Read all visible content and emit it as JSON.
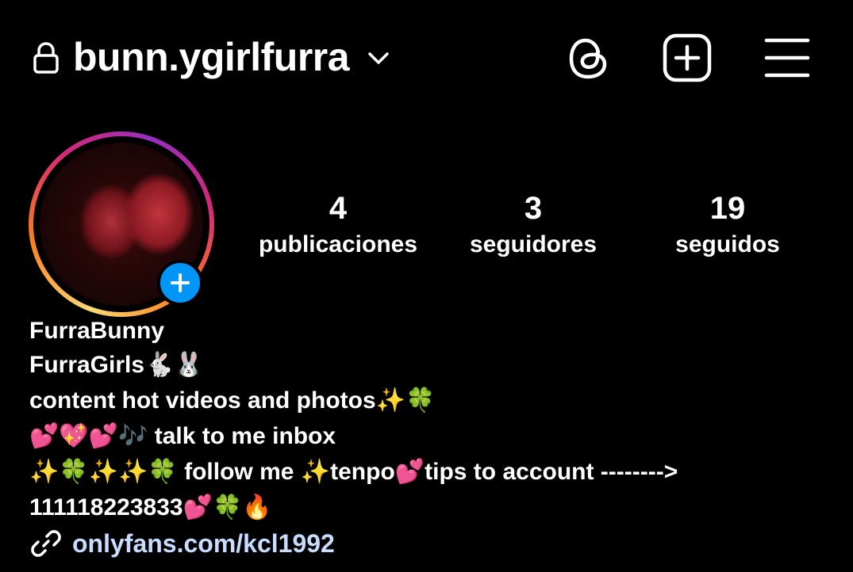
{
  "header": {
    "username": "bunn.ygirlfurra",
    "icons": [
      "lock-icon",
      "chevron-down-icon",
      "threads-icon",
      "add-post-icon",
      "menu-icon"
    ]
  },
  "profile": {
    "avatar": "profile-picture",
    "stats": [
      {
        "value": "4",
        "label": "publicaciones"
      },
      {
        "value": "3",
        "label": "seguidores"
      },
      {
        "value": "19",
        "label": "seguidos"
      }
    ]
  },
  "bio": {
    "name": "FurraBunny",
    "lines": [
      "FurraGirls🐇🐰",
      "content hot videos and photos✨🍀",
      "💕💖💕🎶 talk to me inbox",
      "✨🍀✨✨🍀 follow me ✨tenpo💕tips to account -------->",
      "111118223833💕🍀🔥"
    ],
    "link": "onlyfans.com/kcl1992"
  },
  "colors": {
    "background": "#000000",
    "text": "#ffffff",
    "accent_blue": "#0095f6",
    "link": "#c7dcff"
  }
}
